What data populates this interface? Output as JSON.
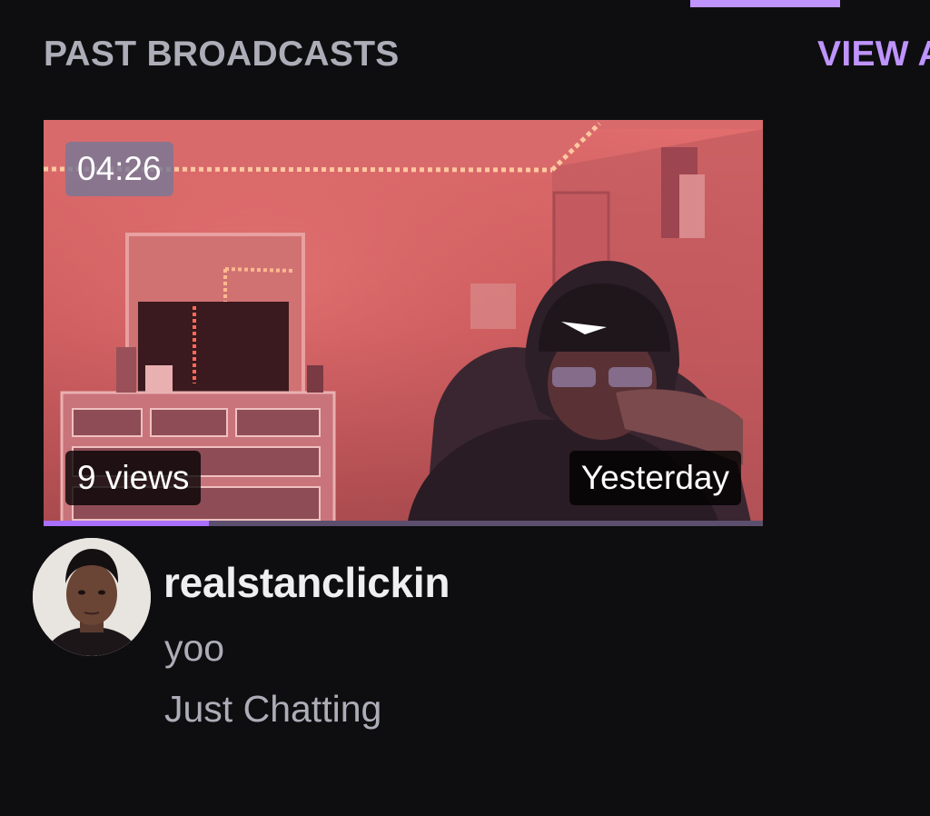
{
  "section": {
    "title": "PAST BROADCASTS",
    "view_all_label": "VIEW ALL"
  },
  "video": {
    "duration": "04:26",
    "views": "9 views",
    "date": "Yesterday",
    "watch_progress_percent": 23
  },
  "channel": {
    "name": "realstanclickin",
    "stream_title": "yoo",
    "category": "Just Chatting"
  },
  "colors": {
    "background": "#0e0e10",
    "accent": "#bf94ff",
    "progress": "#a970ff",
    "muted_text": "#adadb8",
    "primary_text": "#efeff1"
  },
  "icons": {
    "avatar": "channel-avatar",
    "thumbnail": "video-thumbnail"
  }
}
